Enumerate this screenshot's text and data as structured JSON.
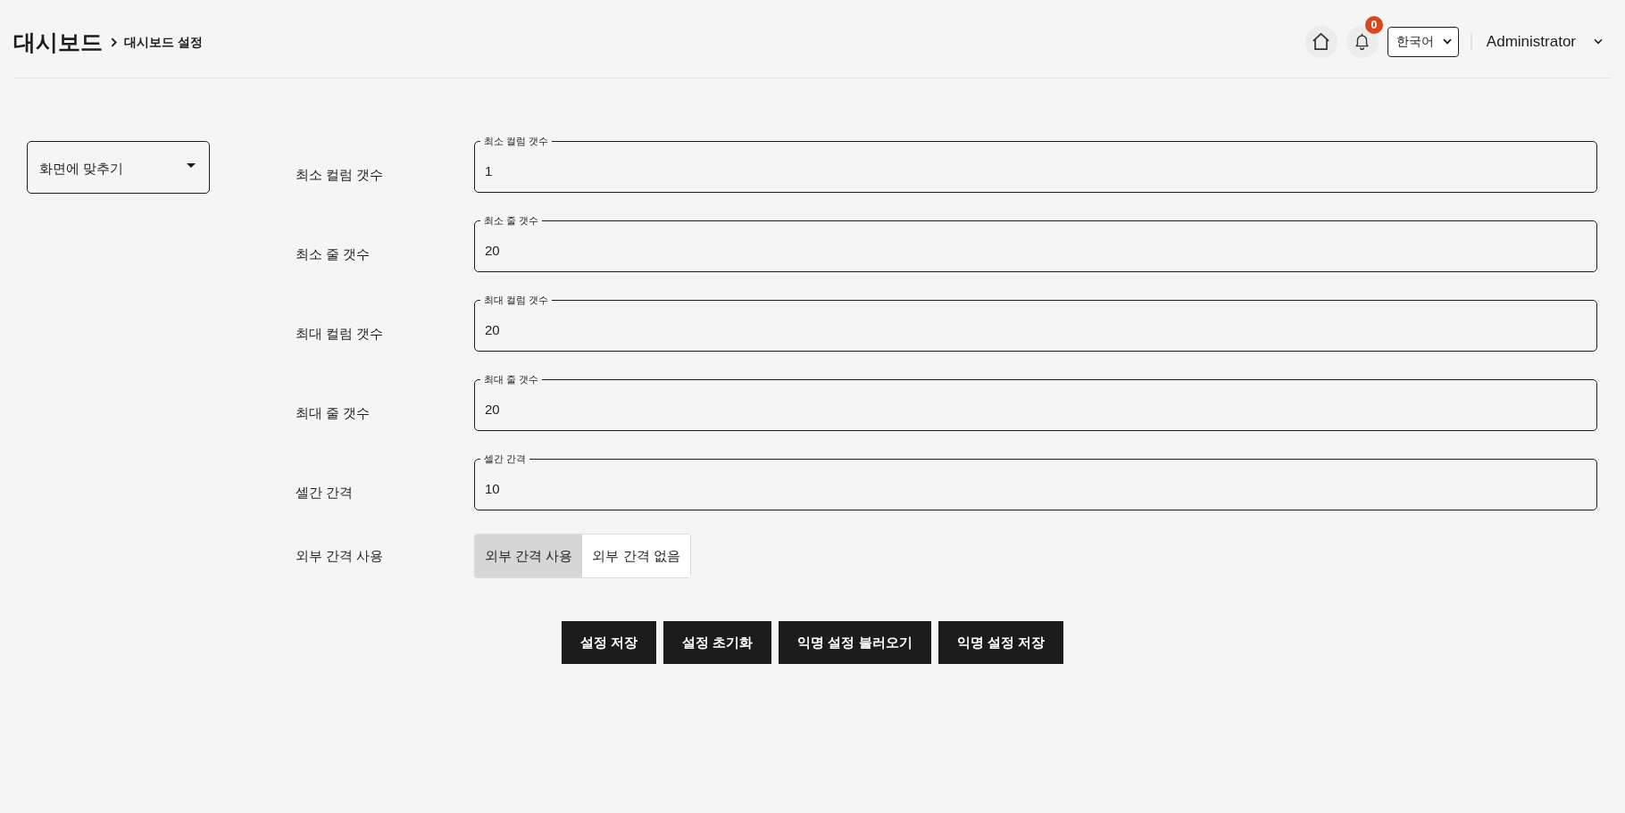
{
  "header": {
    "title": "대시보드",
    "breadcrumb": "대시보드 설정",
    "notifications": {
      "count": "0"
    },
    "language": {
      "value": "한국어"
    },
    "user": {
      "name": "Administrator"
    }
  },
  "layout_select": {
    "value": "화면에 맞추기"
  },
  "settings": [
    {
      "kind": "number",
      "label": "최소 컬럼 갯수",
      "field_label": "최소 컬럼 갯수",
      "value": "1"
    },
    {
      "kind": "number",
      "label": "최소 줄 갯수",
      "field_label": "최소 줄 갯수",
      "value": "20"
    },
    {
      "kind": "number",
      "label": "최대 컬럼 갯수",
      "field_label": "최대 컬럼 갯수",
      "value": "20"
    },
    {
      "kind": "number",
      "label": "최대 줄 갯수",
      "field_label": "최대 줄 갯수",
      "value": "20"
    },
    {
      "kind": "number",
      "label": "셀간 간격",
      "field_label": "셀간 간격",
      "value": "10"
    },
    {
      "kind": "toggle",
      "label": "외부 간격 사용",
      "options": [
        {
          "label": "외부 간격 사용",
          "selected": true
        },
        {
          "label": "외부 간격 없음",
          "selected": false
        }
      ]
    }
  ],
  "actions": [
    "설정 저장",
    "설정 초기화",
    "익명 설정 불러오기",
    "익명 설정 저장"
  ]
}
